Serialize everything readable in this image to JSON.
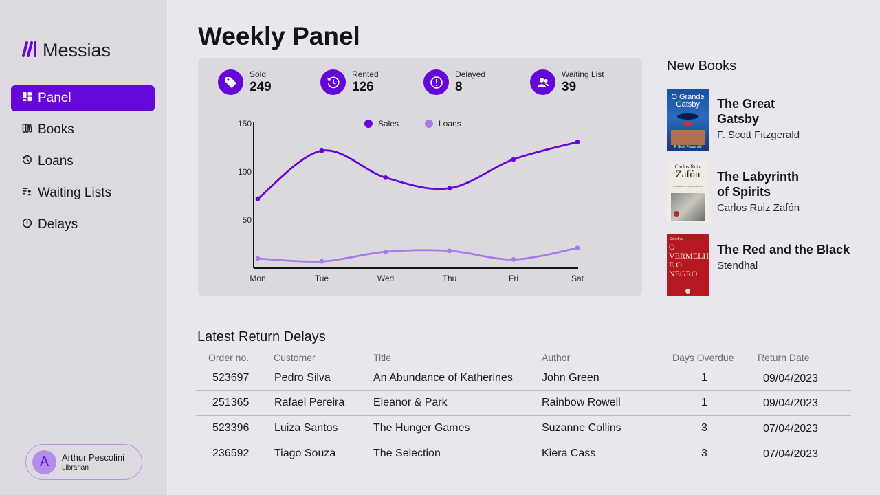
{
  "brand": {
    "name": "Messias"
  },
  "nav": {
    "items": [
      {
        "label": "Panel",
        "icon": "dashboard-icon",
        "active": true
      },
      {
        "label": "Books",
        "icon": "books-icon",
        "active": false
      },
      {
        "label": "Loans",
        "icon": "history-icon",
        "active": false
      },
      {
        "label": "Waiting Lists",
        "icon": "list-person-icon",
        "active": false
      },
      {
        "label": "Delays",
        "icon": "alert-circle-icon",
        "active": false
      }
    ]
  },
  "user": {
    "initial": "A",
    "name": "Arthur Pescolini",
    "role": "Librarian"
  },
  "page": {
    "title": "Weekly Panel"
  },
  "stats": [
    {
      "label": "Sold",
      "value": "249",
      "icon": "tag-icon"
    },
    {
      "label": "Rented",
      "value": "126",
      "icon": "history-icon"
    },
    {
      "label": "Delayed",
      "value": "8",
      "icon": "alert-circle-icon"
    },
    {
      "label": "Waiting List",
      "value": "39",
      "icon": "users-icon"
    }
  ],
  "colors": {
    "accent": "#6507d8",
    "accent_light": "#a87ce6",
    "sidebar": "#dcd9e0",
    "background": "#e9e6ee"
  },
  "chart_data": {
    "type": "line",
    "categories": [
      "Mon",
      "Tue",
      "Wed",
      "Thu",
      "Fri",
      "Sat"
    ],
    "series": [
      {
        "name": "Sales",
        "values": [
          72,
          122,
          94,
          83,
          113,
          131
        ],
        "color": "#6507d8"
      },
      {
        "name": "Loans",
        "values": [
          10,
          7,
          17,
          18,
          9,
          21
        ],
        "color": "#a87ce6"
      }
    ],
    "yticks": [
      50,
      100,
      150
    ],
    "ylim": [
      0,
      150
    ],
    "legend": "top",
    "grid": false
  },
  "new_books": {
    "title": "New Books",
    "items": [
      {
        "title_l1": "The Great",
        "title_l2": "Gatsby",
        "author": "F. Scott Fitzgerald",
        "cover_text": "O Grande Gatsby",
        "cover_author": "F. Scott Fitzgerald"
      },
      {
        "title_l1": "The Labyrinth",
        "title_l2": "of Spirits",
        "author": "Carlos Ruiz Zafón",
        "cover_text": "Zafón",
        "cover_author": "Carlos Ruiz",
        "cover_sub": "O LABIRINTO DOS ESPÍRITOS"
      },
      {
        "title_l1": "The Red and the Black",
        "title_l2": "",
        "author": "Stendhal",
        "cover_text": "O VERMELHO E O NEGRO",
        "cover_author": "Stendhal"
      }
    ]
  },
  "delays": {
    "title": "Latest Return Delays",
    "columns": [
      "Order no.",
      "Customer",
      "Title",
      "Author",
      "Days Overdue",
      "Return Date"
    ],
    "rows": [
      {
        "order": "523697",
        "customer": "Pedro Silva",
        "title": "An Abundance of Katherines",
        "author": "John Green",
        "days": "1",
        "date": "09/04/2023"
      },
      {
        "order": "251365",
        "customer": "Rafael Pereira",
        "title": "Eleanor & Park",
        "author": "Rainbow Rowell",
        "days": "1",
        "date": "09/04/2023"
      },
      {
        "order": "523396",
        "customer": "Luiza Santos",
        "title": "The Hunger Games",
        "author": "Suzanne Collins",
        "days": "3",
        "date": "07/04/2023"
      },
      {
        "order": "236592",
        "customer": "Tiago Souza",
        "title": "The Selection",
        "author": "Kiera Cass",
        "days": "3",
        "date": "07/04/2023"
      }
    ]
  }
}
